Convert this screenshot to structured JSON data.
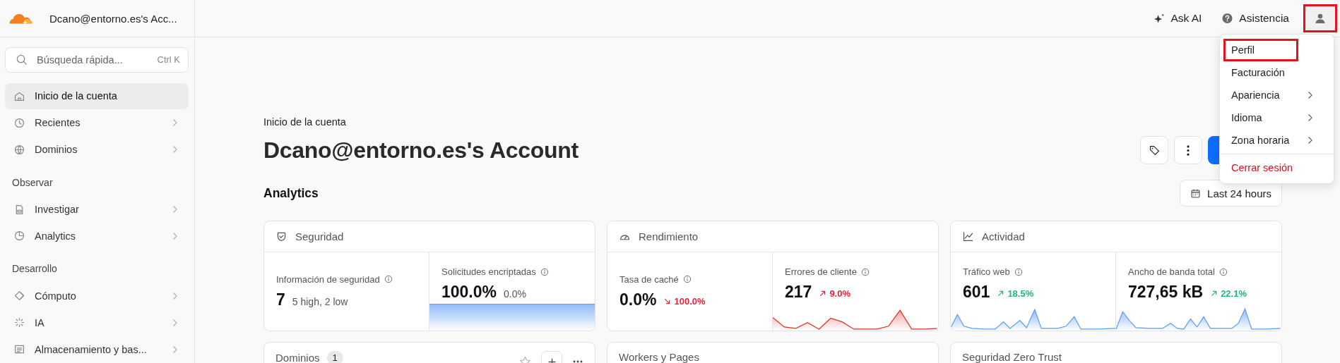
{
  "account_name": "Dcano@entorno.es's Acc...",
  "search": {
    "placeholder": "Búsqueda rápida...",
    "shortcut": "Ctrl K"
  },
  "sidebar": {
    "items": [
      {
        "kind": "link",
        "label": "Inicio de la cuenta",
        "selected": true,
        "expandable": false
      },
      {
        "kind": "link",
        "label": "Recientes",
        "selected": false,
        "expandable": true
      },
      {
        "kind": "link",
        "label": "Dominios",
        "selected": false,
        "expandable": true
      },
      {
        "kind": "heading",
        "label": "Observar"
      },
      {
        "kind": "link",
        "label": "Investigar",
        "selected": false,
        "expandable": true
      },
      {
        "kind": "link",
        "label": "Analytics",
        "selected": false,
        "expandable": true
      },
      {
        "kind": "heading",
        "label": "Desarrollo"
      },
      {
        "kind": "link",
        "label": "Cómputo",
        "selected": false,
        "expandable": true
      },
      {
        "kind": "link",
        "label": "IA",
        "selected": false,
        "expandable": true
      },
      {
        "kind": "link",
        "label": "Almacenamiento y bas...",
        "selected": false,
        "expandable": true
      }
    ]
  },
  "topbar": {
    "ask_ai": "Ask AI",
    "help": "Asistencia",
    "avatar_highlighted": true
  },
  "user_menu": {
    "items": [
      {
        "kind": "item",
        "label": "Perfil",
        "submenu": false,
        "highlighted": true
      },
      {
        "kind": "item",
        "label": "Facturación",
        "submenu": false,
        "highlighted": false
      },
      {
        "kind": "item",
        "label": "Apariencia",
        "submenu": true,
        "highlighted": false
      },
      {
        "kind": "item",
        "label": "Idioma",
        "submenu": true,
        "highlighted": false
      },
      {
        "kind": "item",
        "label": "Zona horaria",
        "submenu": true,
        "highlighted": false
      },
      {
        "kind": "danger",
        "label": "Cerrar sesión",
        "submenu": false,
        "highlighted": false
      }
    ]
  },
  "breadcrumb": "Inicio de la cuenta",
  "title": "Dcano@entorno.es's Account",
  "section_title": "Analytics",
  "time_range": "Last 24 hours",
  "cards": [
    {
      "title": "Seguridad",
      "metrics": [
        {
          "label": "Información de seguridad",
          "value": "7",
          "note": "5 high, 2 low"
        },
        {
          "label": "Solicitudes encriptadas",
          "value": "100.0%",
          "note": "0.0%"
        }
      ]
    },
    {
      "title": "Rendimiento",
      "metrics": [
        {
          "label": "Tasa de caché",
          "value": "0.0%",
          "delta": "100.0%",
          "increase": false,
          "favorable": false
        },
        {
          "label": "Errores de cliente",
          "value": "217",
          "delta": "9.0%",
          "increase": true,
          "favorable": false
        }
      ]
    },
    {
      "title": "Actividad",
      "metrics": [
        {
          "label": "Tráfico web",
          "value": "601",
          "delta": "18.5%",
          "increase": true,
          "favorable": true
        },
        {
          "label": "Ancho de banda total",
          "value": "727,65 kB",
          "delta": "22.1%",
          "increase": true,
          "favorable": true
        }
      ]
    }
  ],
  "panels": [
    {
      "title": "Dominios",
      "count": "1",
      "actions": true
    },
    {
      "title": "Workers y Pages",
      "actions": false
    },
    {
      "title": "Seguridad Zero Trust",
      "actions": false
    }
  ]
}
